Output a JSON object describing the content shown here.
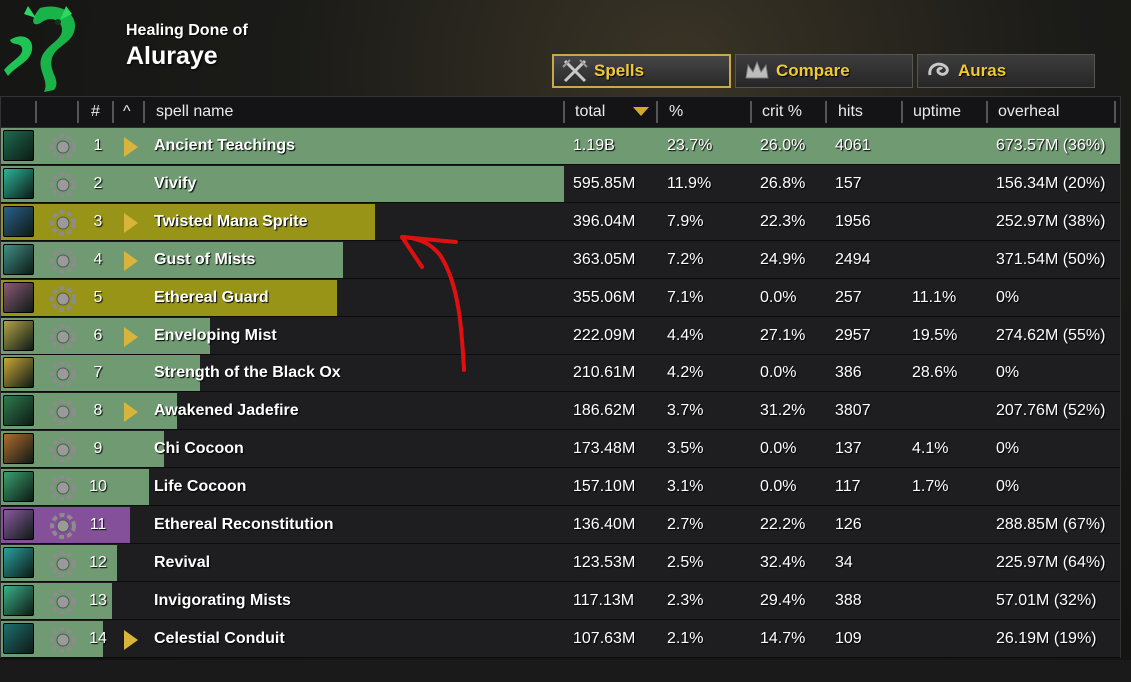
{
  "header": {
    "subtitle": "Healing Done of",
    "player_name": "Aluraye"
  },
  "tabs": [
    {
      "label": "Spells",
      "icon": "crossed-swords-icon",
      "active": true
    },
    {
      "label": "Compare",
      "icon": "crown-icon",
      "active": false
    },
    {
      "label": "Auras",
      "icon": "swirl-icon",
      "active": false
    }
  ],
  "columns": {
    "num": "#",
    "caret": "^",
    "name": "spell name",
    "total": "total",
    "pct": "%",
    "crit": "crit %",
    "hits": "hits",
    "uptime": "uptime",
    "overheal": "overheal"
  },
  "colors": {
    "bar_green": "#6f9a72",
    "bar_yellow": "#979418",
    "bar_purple": "#84509a",
    "accent_gold": "#f0c935",
    "annotation_red": "#e01010"
  },
  "rows": [
    {
      "num": "1",
      "name": "Ancient Teachings",
      "total": "1.19B",
      "pct": "23.7%",
      "crit": "26.0%",
      "hits": "4061",
      "uptime": "",
      "overheal": "673.57M (36%)",
      "expandable": true,
      "bar_fraction": 1.0,
      "bar_color": "green",
      "icon": "jade-serpent-icon"
    },
    {
      "num": "2",
      "name": "Vivify",
      "total": "595.85M",
      "pct": "11.9%",
      "crit": "26.8%",
      "hits": "157",
      "uptime": "",
      "overheal": "156.34M (20%)",
      "expandable": false,
      "bar_fraction": 0.503,
      "bar_color": "green",
      "icon": "vivify-icon"
    },
    {
      "num": "3",
      "name": "Twisted Mana Sprite",
      "total": "396.04M",
      "pct": "7.9%",
      "crit": "22.3%",
      "hits": "1956",
      "uptime": "",
      "overheal": "252.97M (38%)",
      "expandable": true,
      "bar_fraction": 0.334,
      "bar_color": "yellow",
      "icon": "mana-sprite-icon"
    },
    {
      "num": "4",
      "name": "Gust of Mists",
      "total": "363.05M",
      "pct": "7.2%",
      "crit": "24.9%",
      "hits": "2494",
      "uptime": "",
      "overheal": "371.54M (50%)",
      "expandable": true,
      "bar_fraction": 0.306,
      "bar_color": "green",
      "icon": "mist-icon"
    },
    {
      "num": "5",
      "name": "Ethereal Guard",
      "total": "355.06M",
      "pct": "7.1%",
      "crit": "0.0%",
      "hits": "257",
      "uptime": "11.1%",
      "overheal": "0%",
      "expandable": false,
      "bar_fraction": 0.3,
      "bar_color": "yellow",
      "icon": "ethereal-wing-icon"
    },
    {
      "num": "6",
      "name": "Enveloping Mist",
      "total": "222.09M",
      "pct": "4.4%",
      "crit": "27.1%",
      "hits": "2957",
      "uptime": "19.5%",
      "overheal": "274.62M (55%)",
      "expandable": true,
      "bar_fraction": 0.187,
      "bar_color": "green",
      "icon": "enveloping-mist-icon"
    },
    {
      "num": "7",
      "name": "Strength of the Black Ox",
      "total": "210.61M",
      "pct": "4.2%",
      "crit": "0.0%",
      "hits": "386",
      "uptime": "28.6%",
      "overheal": "0%",
      "expandable": false,
      "bar_fraction": 0.178,
      "bar_color": "green",
      "icon": "black-ox-icon"
    },
    {
      "num": "8",
      "name": "Awakened Jadefire",
      "total": "186.62M",
      "pct": "3.7%",
      "crit": "31.2%",
      "hits": "3807",
      "uptime": "",
      "overheal": "207.76M (52%)",
      "expandable": true,
      "bar_fraction": 0.157,
      "bar_color": "green",
      "icon": "jadefire-icon"
    },
    {
      "num": "9",
      "name": "Chi Cocoon",
      "total": "173.48M",
      "pct": "3.5%",
      "crit": "0.0%",
      "hits": "137",
      "uptime": "4.1%",
      "overheal": "0%",
      "expandable": false,
      "bar_fraction": 0.146,
      "bar_color": "green",
      "icon": "chi-cocoon-icon"
    },
    {
      "num": "10",
      "name": "Life Cocoon",
      "total": "157.10M",
      "pct": "3.1%",
      "crit": "0.0%",
      "hits": "117",
      "uptime": "1.7%",
      "overheal": "0%",
      "expandable": false,
      "bar_fraction": 0.132,
      "bar_color": "green",
      "icon": "life-cocoon-icon"
    },
    {
      "num": "11",
      "name": "Ethereal Reconstitution",
      "total": "136.40M",
      "pct": "2.7%",
      "crit": "22.2%",
      "hits": "126",
      "uptime": "",
      "overheal": "288.85M (67%)",
      "expandable": false,
      "bar_fraction": 0.115,
      "bar_color": "purple",
      "icon": "ethereal-reconstitution-icon"
    },
    {
      "num": "12",
      "name": "Revival",
      "total": "123.53M",
      "pct": "2.5%",
      "crit": "32.4%",
      "hits": "34",
      "uptime": "",
      "overheal": "225.97M (64%)",
      "expandable": false,
      "bar_fraction": 0.104,
      "bar_color": "green",
      "icon": "revival-icon"
    },
    {
      "num": "13",
      "name": "Invigorating Mists",
      "total": "117.13M",
      "pct": "2.3%",
      "crit": "29.4%",
      "hits": "388",
      "uptime": "",
      "overheal": "57.01M (32%)",
      "expandable": false,
      "bar_fraction": 0.099,
      "bar_color": "green",
      "icon": "invigorating-mists-icon"
    },
    {
      "num": "14",
      "name": "Celestial Conduit",
      "total": "107.63M",
      "pct": "2.1%",
      "crit": "14.7%",
      "hits": "109",
      "uptime": "",
      "overheal": "26.19M (19%)",
      "expandable": true,
      "bar_fraction": 0.091,
      "bar_color": "green",
      "icon": "celestial-conduit-icon"
    }
  ]
}
